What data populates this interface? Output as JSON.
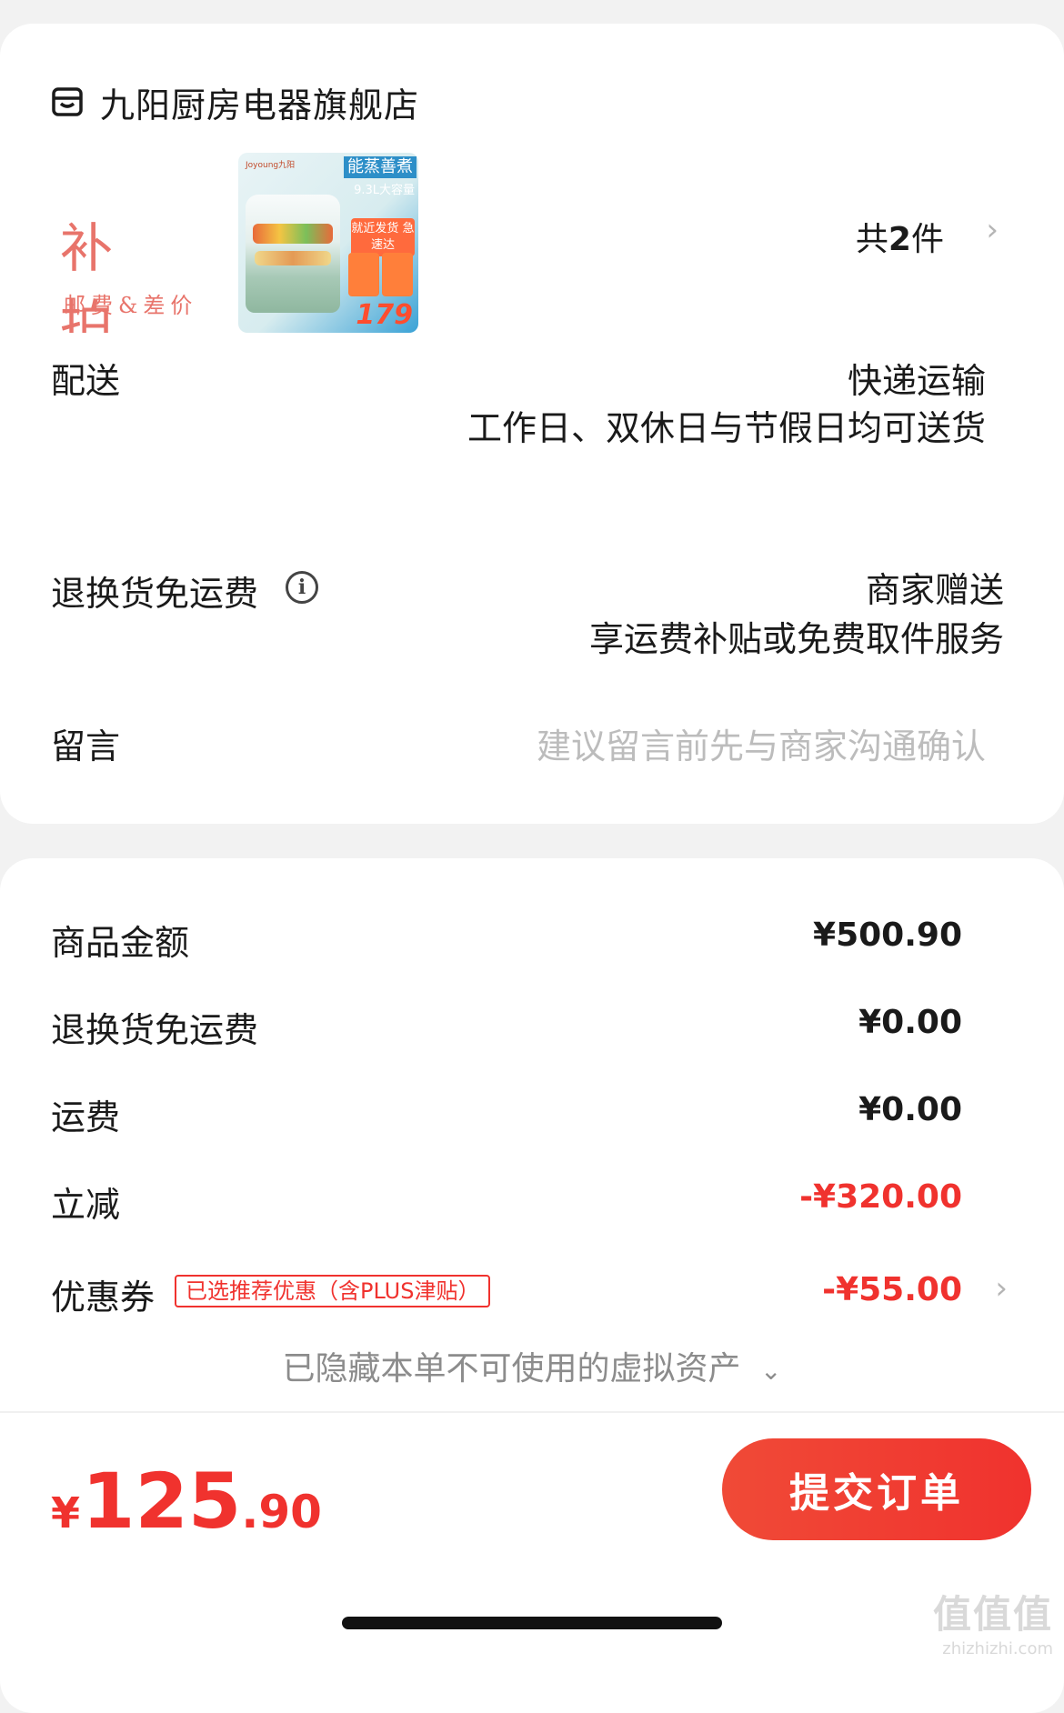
{
  "store": {
    "name": "九阳厨房电器旗舰店",
    "icon": "store-icon"
  },
  "items": {
    "thumb1": {
      "line1": "补 拍",
      "line2": "邮费&差价"
    },
    "thumb2": {
      "brand": "Joyoung九阳",
      "tag1": "能蒸善煮",
      "tag2": "9.3L大容量",
      "tag3": "就近发货 急速达",
      "price": "179"
    },
    "count_prefix": "共",
    "count_value": "2",
    "count_suffix": "件"
  },
  "delivery": {
    "label": "配送",
    "method": "快递运输",
    "note": "工作日、双休日与节假日均可送货"
  },
  "return_shipping": {
    "label": "退换货免运费",
    "value": "商家赠送",
    "note": "享运费补贴或免费取件服务"
  },
  "message": {
    "label": "留言",
    "placeholder": "建议留言前先与商家沟通确认"
  },
  "summary": {
    "goods_label": "商品金额",
    "goods_value": "¥500.90",
    "return_label": "退换货免运费",
    "return_value": "¥0.00",
    "shipping_label": "运费",
    "shipping_value": "¥0.00",
    "discount_label": "立减",
    "discount_value": "-¥320.00",
    "coupon_label": "优惠券",
    "coupon_tag": "已选推荐优惠（含PLUS津贴）",
    "coupon_value": "-¥55.00",
    "hidden_note": "已隐藏本单不可使用的虚拟资产"
  },
  "footer": {
    "currency": "¥",
    "total_int": "125",
    "total_dec": ".90",
    "submit_label": "提交订单"
  },
  "watermark": {
    "big": "值值值",
    "small": "zhizhizhi.com"
  },
  "colors": {
    "accent": "#f0322e",
    "thumb_text": "#e8746b",
    "placeholder": "#bcbcbc",
    "muted": "#8c8c8c"
  }
}
